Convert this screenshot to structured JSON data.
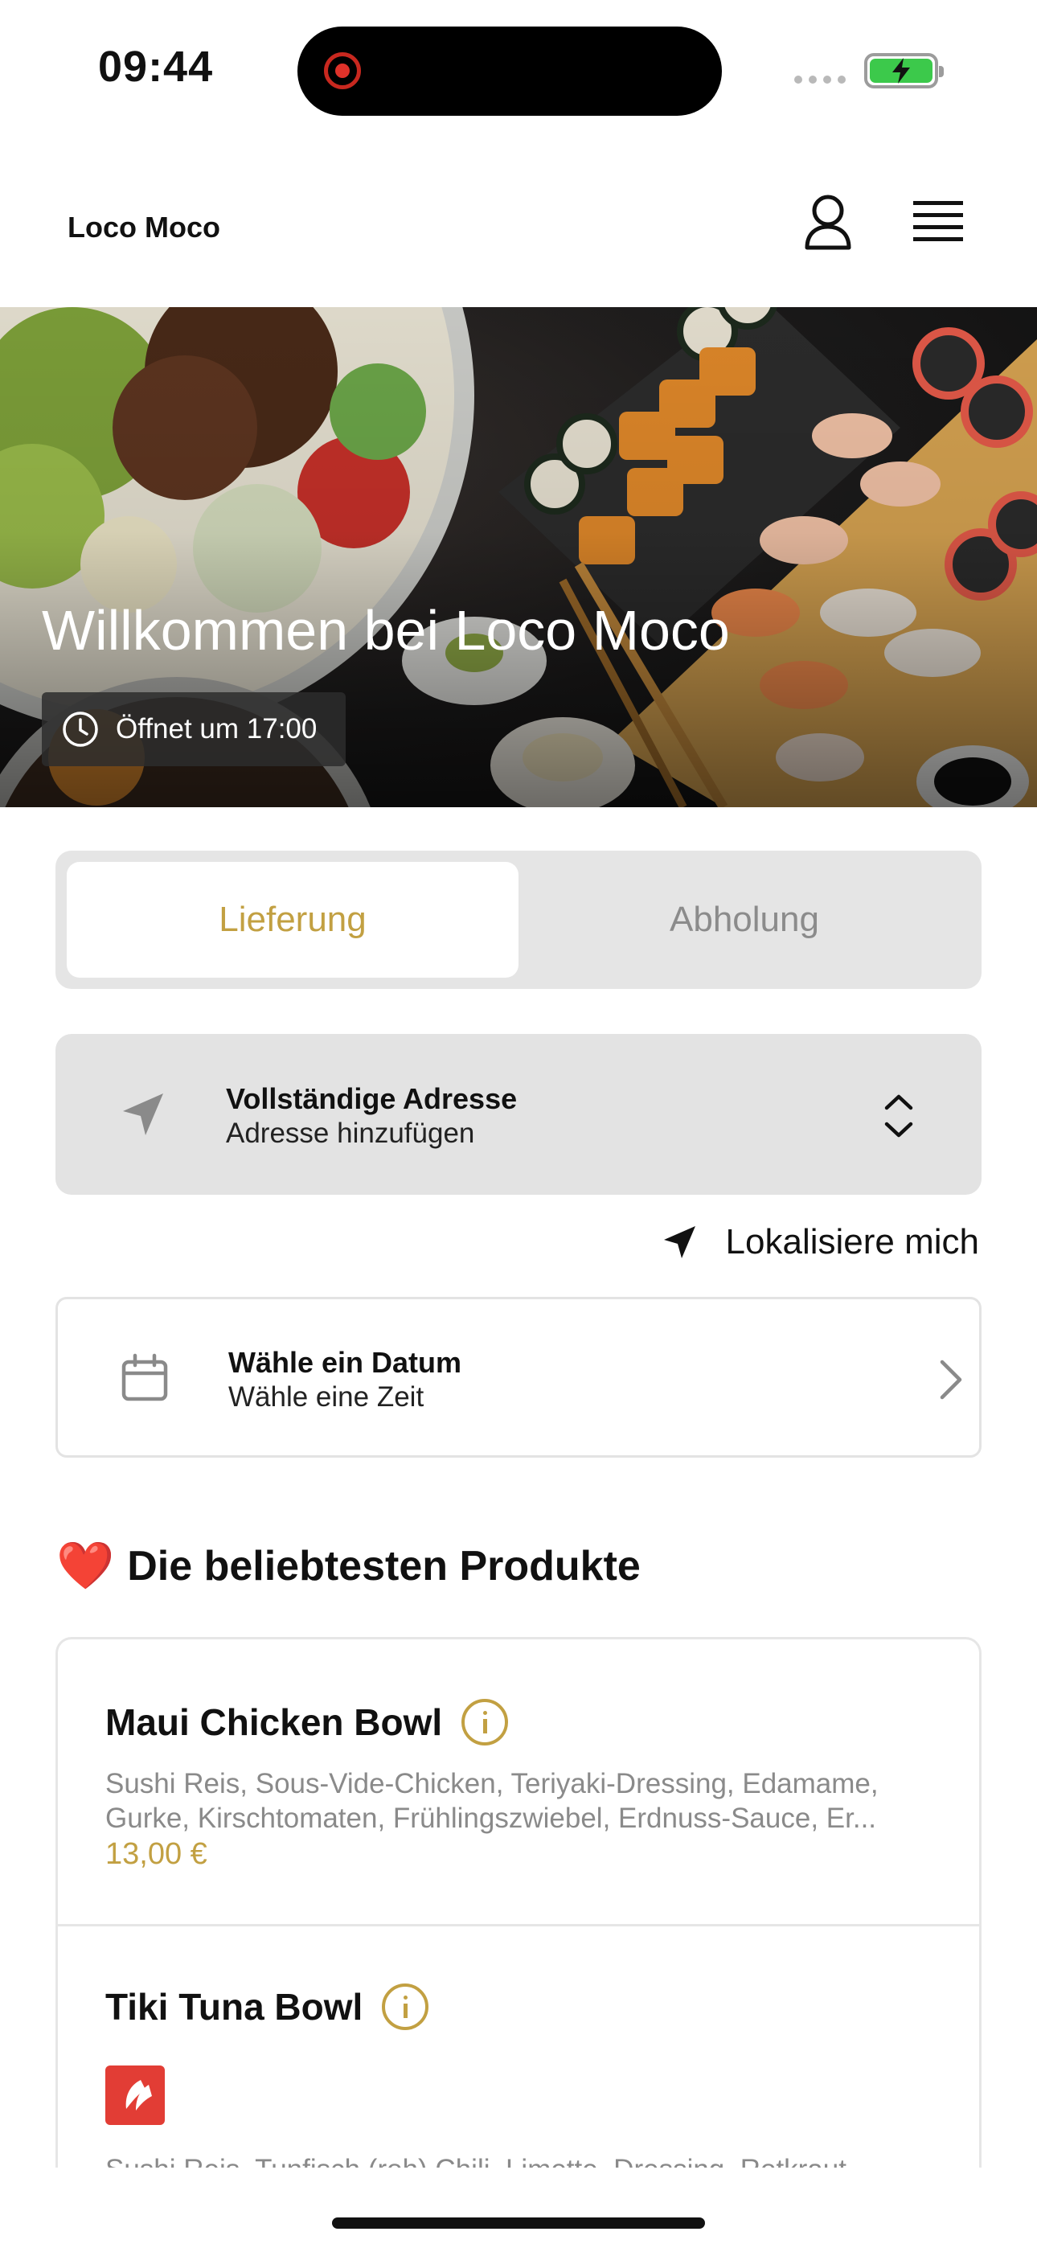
{
  "status_bar": {
    "time": "09:44"
  },
  "header": {
    "brand": "Loco Moco",
    "user_icon": "user-icon",
    "menu_icon": "hamburger-menu-icon"
  },
  "hero": {
    "title": "Willkommen bei Loco Moco",
    "opening_text": "Öffnet um 17:00",
    "clock_icon": "clock-icon"
  },
  "order_mode": {
    "options": [
      "Lieferung",
      "Abholung"
    ],
    "selected": "Lieferung"
  },
  "address": {
    "title": "Vollständige Adresse",
    "subtitle": "Adresse hinzufügen"
  },
  "locate_label": "Lokalisiere mich",
  "schedule": {
    "title": "Wähle ein Datum",
    "subtitle": "Wähle eine Zeit"
  },
  "popular": {
    "heading": "Die beliebtesten Produkte",
    "products": [
      {
        "name": "Maui Chicken Bowl",
        "description": "Sushi Reis, Sous-Vide-Chicken, Teriyaki-Dressing, Edamame, Gurke, Kirschtomaten, Frühlingszwiebel, Erdnuss-Sauce, Er...",
        "price": "13,00 €"
      },
      {
        "name": "Tiki Tuna Bowl",
        "badge_icon": "chili-spicy-icon",
        "description": "Sushi Reis, Tunfisch (roh) Chili, Limette, Dressing, Rotkraut"
      }
    ]
  },
  "colors": {
    "accent": "#c2a042",
    "spicy": "#e23d35",
    "battery": "#3cc94b"
  }
}
